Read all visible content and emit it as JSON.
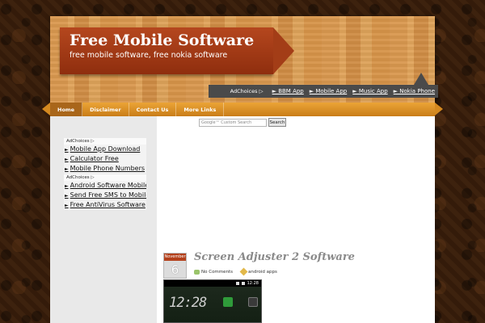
{
  "header": {
    "title": "Free Mobile Software",
    "description": "free mobile software, free nokia software"
  },
  "adbar": {
    "adchoices": "AdChoices ▷",
    "links": [
      "► BBM App",
      "► Mobile App",
      "► Music App",
      "► Nokia Phone"
    ]
  },
  "nav": {
    "items": [
      "Home",
      "Disclaimer",
      "Contact Us",
      "More Links"
    ]
  },
  "search": {
    "placeholder": "Google™ Custom Search",
    "button": "Search"
  },
  "sidebar": {
    "block1": {
      "label": "AdChoices ▷",
      "links": [
        "Mobile App Download",
        "Calculator Free",
        "Mobile Phone Numbers"
      ]
    },
    "block2": {
      "label": "AdChoices ▷",
      "links": [
        "Android Software Mobile",
        "Send Free SMS to Mobile",
        "Free AntiVirus Software"
      ]
    },
    "triangle": "►"
  },
  "post": {
    "month": "November",
    "day": "6",
    "title": "Screen Adjuster 2 Software",
    "comments": "No Comments",
    "category": "android apps",
    "phone_time": "12:28",
    "phone_clock": "12:28"
  },
  "colors": {
    "banner": "#a33d17",
    "nav": "#d48920",
    "adbar": "#4a4a4a"
  }
}
